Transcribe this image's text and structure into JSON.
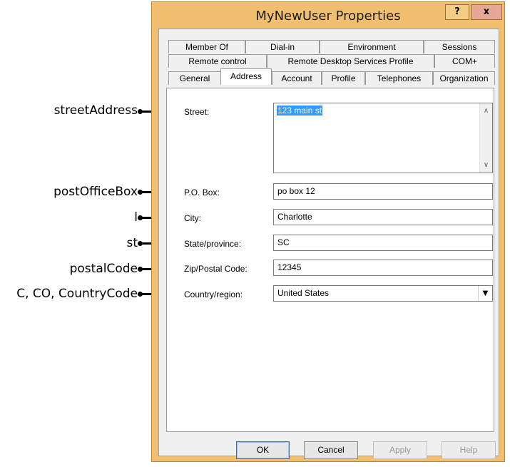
{
  "callouts": {
    "street": "streetAddress",
    "pobox": "postOfficeBox",
    "city": "l",
    "state": "st",
    "zip": "postalCode",
    "country": "C, CO, CountryCode"
  },
  "window": {
    "title": "MyNewUser Properties",
    "help_glyph": "?",
    "close_glyph": "x"
  },
  "tabs": {
    "row1": [
      "Member Of",
      "Dial-in",
      "Environment",
      "Sessions"
    ],
    "row2": [
      "Remote control",
      "Remote Desktop Services Profile",
      "COM+"
    ],
    "row3": [
      "General",
      "Address",
      "Account",
      "Profile",
      "Telephones",
      "Organization"
    ],
    "active": "Address"
  },
  "form": {
    "street_label": "Street:",
    "street_value": "123 main st",
    "pobox_label": "P.O. Box:",
    "pobox_value": "po box 12",
    "city_label": "City:",
    "city_value": "Charlotte",
    "state_label": "State/province:",
    "state_value": "SC",
    "zip_label": "Zip/Postal Code:",
    "zip_value": "12345",
    "country_label": "Country/region:",
    "country_value": "United States"
  },
  "buttons": {
    "ok": "OK",
    "cancel": "Cancel",
    "apply": "Apply",
    "help": "Help"
  },
  "icons": {
    "scroll_up": "chevron-up-icon",
    "scroll_down": "chevron-down-icon",
    "dropdown": "triangle-down-icon"
  },
  "colors": {
    "window_frame": "#f0c070",
    "selection": "#3399ff",
    "close_button": "#e8a898"
  }
}
